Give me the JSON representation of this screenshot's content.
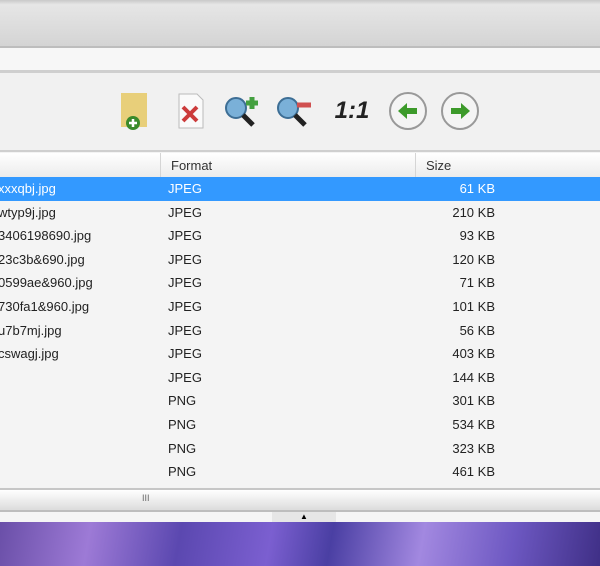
{
  "toolbar": {
    "buttons": [
      {
        "name": "add-image-icon",
        "label": ""
      },
      {
        "name": "delete-icon",
        "label": ""
      },
      {
        "name": "zoom-in-icon",
        "label": ""
      },
      {
        "name": "zoom-out-icon",
        "label": ""
      },
      {
        "name": "actual-size",
        "label": "1:1"
      },
      {
        "name": "previous-icon",
        "label": ""
      },
      {
        "name": "next-icon",
        "label": ""
      }
    ]
  },
  "columns": {
    "name": "",
    "format": "Format",
    "size": "Size"
  },
  "rows": [
    {
      "name": "xxxqbj.jpg",
      "format": "JPEG",
      "size": "61 KB"
    },
    {
      "name": "wtyp9j.jpg",
      "format": "JPEG",
      "size": "210 KB"
    },
    {
      "name": "3406198690.jpg",
      "format": "JPEG",
      "size": "93 KB"
    },
    {
      "name": "23c3b&690.jpg",
      "format": "JPEG",
      "size": "120 KB"
    },
    {
      "name": "0599ae&960.jpg",
      "format": "JPEG",
      "size": "71 KB"
    },
    {
      "name": "730fa1&960.jpg",
      "format": "JPEG",
      "size": "101 KB"
    },
    {
      "name": "u7b7mj.jpg",
      "format": "JPEG",
      "size": "56 KB"
    },
    {
      "name": "cswagj.jpg",
      "format": "JPEG",
      "size": "403 KB"
    },
    {
      "name": "",
      "format": "JPEG",
      "size": "144 KB"
    },
    {
      "name": "",
      "format": "PNG",
      "size": "301 KB"
    },
    {
      "name": "",
      "format": "PNG",
      "size": "534 KB"
    },
    {
      "name": "",
      "format": "PNG",
      "size": "323 KB"
    },
    {
      "name": "",
      "format": "PNG",
      "size": "461 KB"
    }
  ],
  "scrollbar": {
    "grip": "III"
  },
  "splitter": {
    "arrow": "▲"
  }
}
